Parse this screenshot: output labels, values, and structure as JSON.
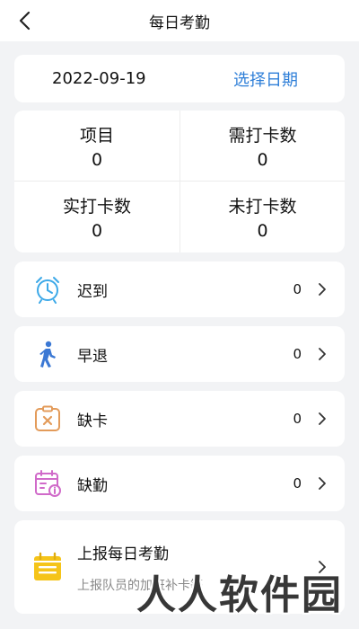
{
  "header": {
    "title": "每日考勤"
  },
  "date_bar": {
    "date": "2022-09-19",
    "picker_label": "选择日期"
  },
  "stats": [
    {
      "label": "项目",
      "value": "0"
    },
    {
      "label": "需打卡数",
      "value": "0"
    },
    {
      "label": "实打卡数",
      "value": "0"
    },
    {
      "label": "未打卡数",
      "value": "0"
    }
  ],
  "items": [
    {
      "label": "迟到",
      "count": "0",
      "icon": "alarm-clock-icon",
      "color": "#3da9e8"
    },
    {
      "label": "早退",
      "count": "0",
      "icon": "walking-person-icon",
      "color": "#3b78d4"
    },
    {
      "label": "缺卡",
      "count": "0",
      "icon": "clipboard-x-icon",
      "color": "#e39b5a"
    },
    {
      "label": "缺勤",
      "count": "0",
      "icon": "calendar-info-icon",
      "color": "#d06ac9"
    }
  ],
  "report": {
    "title": "上报每日考勤",
    "subtitle": "上报队员的加班补卡等",
    "icon": "calendar-report-icon",
    "color": "#f5c419"
  },
  "watermark": {
    "text": "人人软件园"
  },
  "colors": {
    "accent": "#2f7fd8",
    "background": "#f2f3f5"
  }
}
